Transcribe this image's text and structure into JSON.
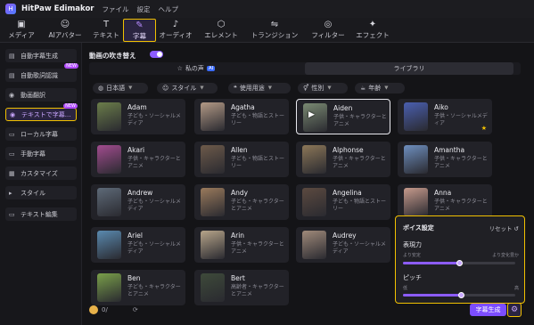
{
  "app": {
    "title": "HitPaw Edimakor",
    "logo_text": "H"
  },
  "menu": [
    "ファイル",
    "設定",
    "ヘルプ"
  ],
  "toolbar": [
    {
      "label": "メディア",
      "icon": "media-icon",
      "glyph": "▣"
    },
    {
      "label": "AIアバター",
      "icon": "ai-avatar-icon",
      "glyph": "☺"
    },
    {
      "label": "テキスト",
      "icon": "text-icon",
      "glyph": "T"
    },
    {
      "label": "字幕",
      "icon": "subtitle-icon",
      "glyph": "✎"
    },
    {
      "label": "オーディオ",
      "icon": "audio-icon",
      "glyph": "♪"
    },
    {
      "label": "エレメント",
      "icon": "element-icon",
      "glyph": "⬡"
    },
    {
      "label": "トランジション",
      "icon": "transition-icon",
      "glyph": "⇋"
    },
    {
      "label": "フィルター",
      "icon": "filter-icon",
      "glyph": "◎"
    },
    {
      "label": "エフェクト",
      "icon": "effect-icon",
      "glyph": "✦"
    }
  ],
  "sidebar": [
    {
      "label": "自動字幕生成",
      "glyph": "▤"
    },
    {
      "label": "自動歌詞認識",
      "glyph": "▤",
      "badge": "NEW"
    },
    {
      "label": "動画翻訳",
      "glyph": "◉"
    },
    {
      "label": "テキストで字幕...",
      "glyph": "◉",
      "badge": "NEW"
    },
    {
      "label": "ローカル字幕",
      "glyph": "▭"
    },
    {
      "label": "手動字幕",
      "glyph": "▭"
    },
    {
      "label": "カスタマイズ",
      "glyph": "▦"
    },
    {
      "label": "スタイル",
      "glyph": "▸"
    },
    {
      "label": "テキスト編集",
      "glyph": "▭"
    }
  ],
  "voice_replace": {
    "label": "動画の吹き替え",
    "enabled": true
  },
  "tabs": {
    "my_voice": "私の声",
    "ai_badge": "AI",
    "library": "ライブラリ"
  },
  "filters": [
    {
      "label": "日本語",
      "glyph": "◍"
    },
    {
      "label": "スタイル",
      "glyph": "☺"
    },
    {
      "label": "使用用途",
      "glyph": "❝"
    },
    {
      "label": "性別",
      "glyph": "⚥"
    },
    {
      "label": "年齢",
      "glyph": "☕"
    }
  ],
  "voices": [
    {
      "name": "Adam",
      "desc": "子ども・ソーシャルメディア",
      "color": "#6b7d4a"
    },
    {
      "name": "Agatha",
      "desc": "子ども・物語とストーリー",
      "color": "#b39a86"
    },
    {
      "name": "Aiden",
      "desc": "子供・キャラクターとアニメ",
      "color": "#7a8a72",
      "selected": true
    },
    {
      "name": "Aiko",
      "desc": "子供・ソーシャルメディア",
      "color": "#4a5fb0",
      "star": true
    },
    {
      "name": "Akari",
      "desc": "子供・キャラクターとアニメ",
      "color": "#a24c8f"
    },
    {
      "name": "Allen",
      "desc": "子ども・物語とストーリー",
      "color": "#6d5a4a"
    },
    {
      "name": "Alphonse",
      "desc": "子供・キャラクターとアニメ",
      "color": "#8c7758"
    },
    {
      "name": "Amantha",
      "desc": "子供・キャラクターとアニメ",
      "color": "#6e8fbf"
    },
    {
      "name": "Andrew",
      "desc": "子ども・ソーシャルメディア",
      "color": "#5e6a78"
    },
    {
      "name": "Andy",
      "desc": "子ども・キャラクターとアニメ",
      "color": "#9a7a5c"
    },
    {
      "name": "Angelina",
      "desc": "子ども・物語とストーリー",
      "color": "#5c4a40"
    },
    {
      "name": "Anna",
      "desc": "子供・キャラクターとアニメ",
      "color": "#c69a8c"
    },
    {
      "name": "Ariel",
      "desc": "子ども・ソーシャルメディア",
      "color": "#5a8ab0"
    },
    {
      "name": "Arin",
      "desc": "子供・キャラクターとアニメ",
      "color": "#b7a58a"
    },
    {
      "name": "Audrey",
      "desc": "子ども・ソーシャルメディア",
      "color": "#a08a7a"
    },
    {
      "name": "Basilio Sahur",
      "desc": "中年・ソーシャルメディア",
      "color": "#5e7a3e"
    },
    {
      "name": "Ben",
      "desc": "子ども・キャラクターとアニメ",
      "color": "#7aa04a"
    },
    {
      "name": "Bert",
      "desc": "高齢者・キャラクターとアニメ",
      "color": "#3e4a3a"
    }
  ],
  "voice_settings": {
    "title": "ボイス設定",
    "reset": "リセット",
    "expressiveness": {
      "label": "表現力",
      "min_label": "より安定",
      "max_label": "より変化豊か",
      "value": 0.5
    },
    "pitch": {
      "label": "ピッチ",
      "min_label": "低",
      "max_label": "高",
      "value": 0.52
    }
  },
  "bottom": {
    "credits": "0/",
    "generate_label": "字幕生成"
  }
}
